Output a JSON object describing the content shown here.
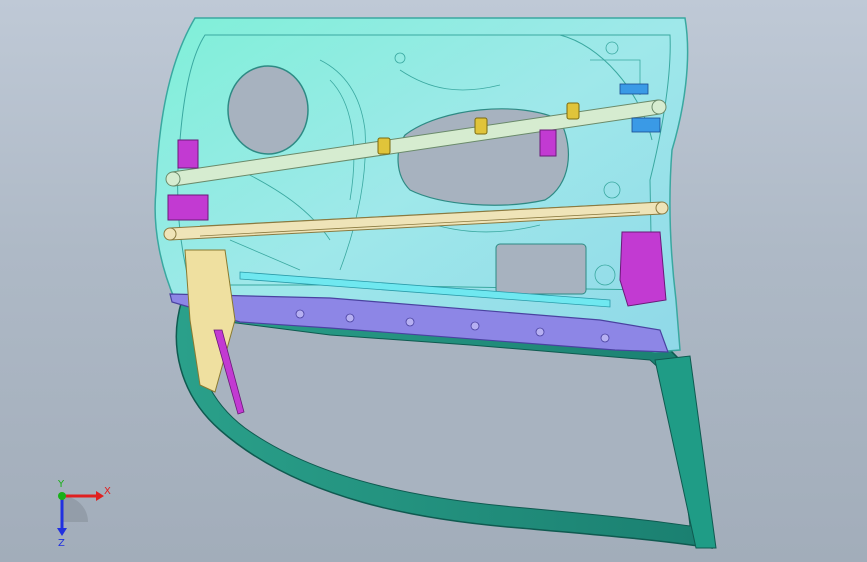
{
  "viewport": {
    "background_top": "#bfc9d6",
    "background_bottom": "#a2adba"
  },
  "model": {
    "name": "",
    "colors": {
      "inner_panel": "#8fe8e0",
      "panel_edge": "#3aa8a0",
      "glass_frame": "#1f8f7e",
      "window_rail": "#8d86e6",
      "beam": "#d6ecd0",
      "lower_beam": "#efe4b8",
      "brackets": "#c23ad2",
      "clips": "#e0c43a",
      "speaker_hole": "#a7b2bf"
    }
  },
  "triad": {
    "x_label": "X",
    "y_label": "Y",
    "z_label": "Z",
    "x_color": "#e02020",
    "y_color": "#18b018",
    "z_color": "#2030e0"
  }
}
